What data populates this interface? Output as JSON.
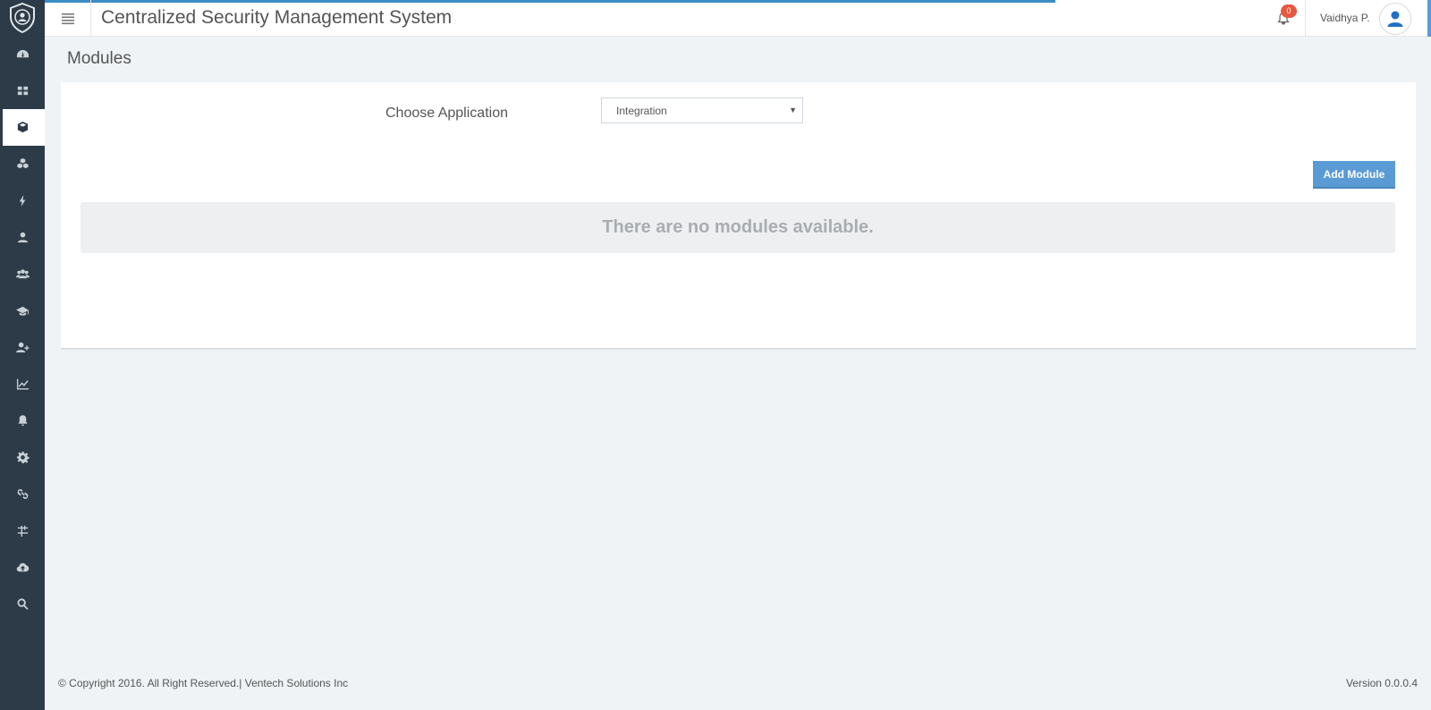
{
  "header": {
    "title": "Centralized Security Management System",
    "notification_count": "0",
    "user_name": "Vaidhya P."
  },
  "sidebar": {
    "items": [
      {
        "icon": "dashboard-icon"
      },
      {
        "icon": "grid-icon"
      },
      {
        "icon": "cube-icon",
        "active": true
      },
      {
        "icon": "cubes-icon"
      },
      {
        "icon": "bolt-icon"
      },
      {
        "icon": "user-icon"
      },
      {
        "icon": "users-icon"
      },
      {
        "icon": "graduation-cap-icon"
      },
      {
        "icon": "user-plus-icon"
      },
      {
        "icon": "line-chart-icon"
      },
      {
        "icon": "bell-icon"
      },
      {
        "icon": "gear-icon"
      },
      {
        "icon": "link-icon"
      },
      {
        "icon": "sliders-icon"
      },
      {
        "icon": "cloud-upload-icon"
      },
      {
        "icon": "search-icon"
      }
    ]
  },
  "page": {
    "title": "Modules",
    "choose_label": "Choose Application",
    "selected_application": "Integration",
    "add_button_label": "Add Module",
    "empty_message": "There are no modules available."
  },
  "footer": {
    "copyright": "© Copyright 2016. All Right Reserved.| Ventech Solutions Inc",
    "version": "Version 0.0.0.4"
  },
  "colors": {
    "sidebar_bg": "#2d3a47",
    "accent": "#5b9bd5",
    "badge": "#e8573f",
    "page_bg": "#eff3f6"
  }
}
